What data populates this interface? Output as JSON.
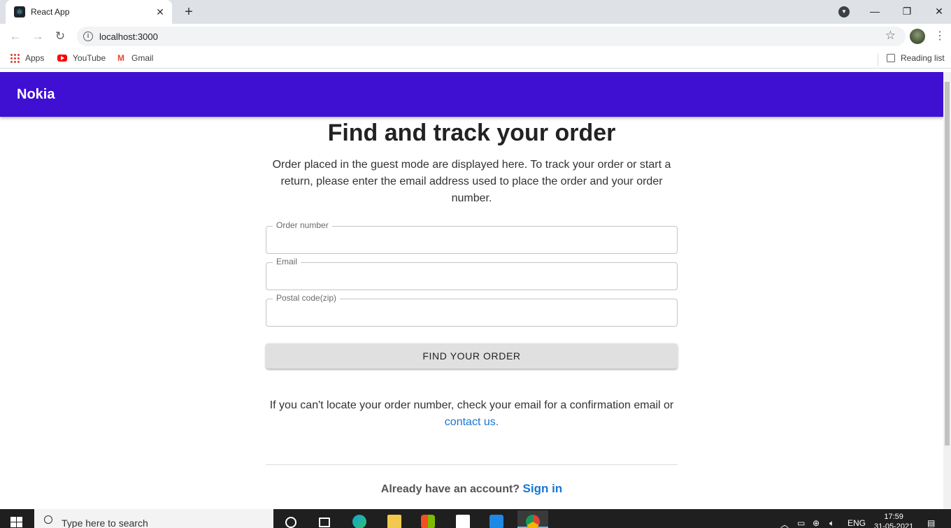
{
  "browser": {
    "tab_title": "React App",
    "url": "localhost:3000",
    "bookmarks": [
      {
        "label": "Apps",
        "icon": "apps-grid-icon"
      },
      {
        "label": "YouTube",
        "icon": "youtube-icon"
      },
      {
        "label": "Gmail",
        "icon": "gmail-icon"
      }
    ],
    "reading_list_label": "Reading list"
  },
  "app": {
    "brand": "Nokia",
    "brand_color": "#3f0fd2",
    "heading": "Find and track your order",
    "description": "Order placed in the guest mode are displayed here. To track your order or start a return, please enter the email address used to place the order and your order number.",
    "fields": [
      {
        "label": "Order number",
        "value": ""
      },
      {
        "label": "Email",
        "value": ""
      },
      {
        "label": "Postal code(zip)",
        "value": ""
      }
    ],
    "find_button_label": "FIND YOUR ORDER",
    "help_text": "If you can't locate your order number, check your email for a confirmation email or",
    "contact_link": "contact us",
    "contact_suffix": ".",
    "account_question": "Already have an account?",
    "signin_link": "Sign in"
  },
  "taskbar": {
    "search_placeholder": "Type here to search",
    "language": "ENG",
    "time": "17:59",
    "date": "31-05-2021"
  }
}
